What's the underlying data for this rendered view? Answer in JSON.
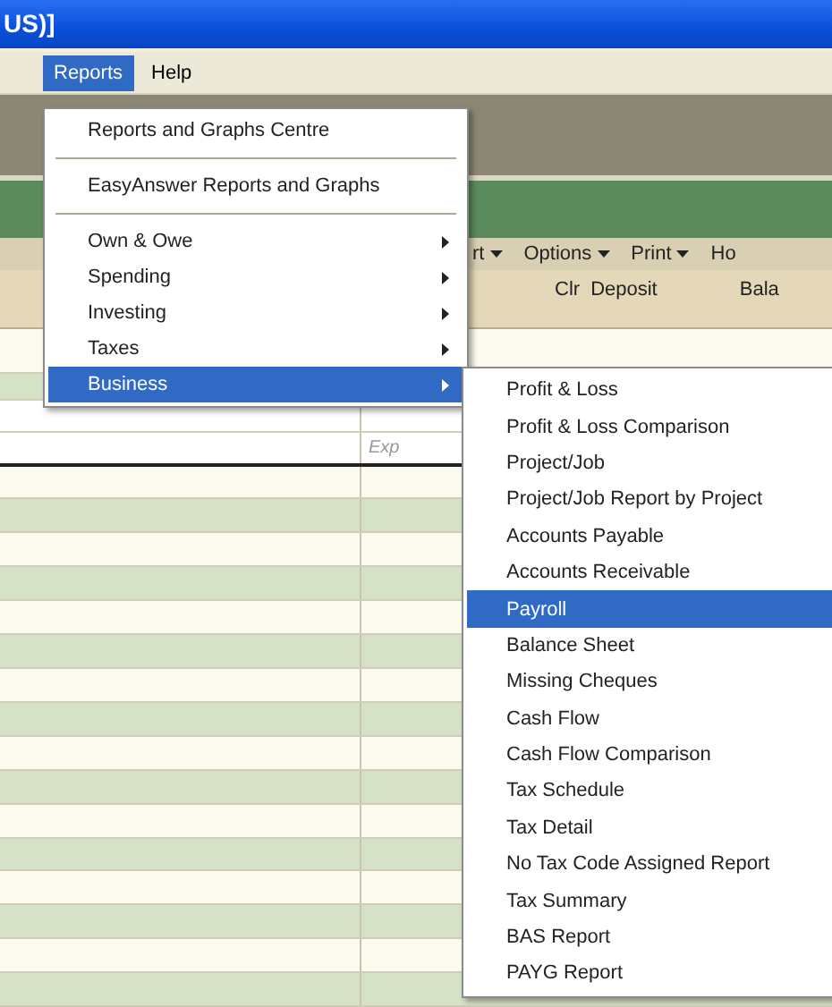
{
  "window": {
    "title": "US)]"
  },
  "menubar": [
    {
      "label": "Reports",
      "selected": true
    },
    {
      "label": "Help",
      "selected": false
    }
  ],
  "toolbar": [
    {
      "label": "rt",
      "dropdown": true
    },
    {
      "label": "Options",
      "dropdown": true
    },
    {
      "label": "Print",
      "dropdown": true
    },
    {
      "label": "Ho",
      "dropdown": false
    }
  ],
  "register": {
    "columns": [
      "Clr",
      "Deposit",
      "Bala"
    ],
    "memo": "Exp"
  },
  "reports_menu": {
    "items": [
      {
        "kind": "item",
        "label": "Reports and Graphs Centre",
        "submenu": false,
        "selected": false
      },
      {
        "kind": "separator"
      },
      {
        "kind": "item",
        "label": "EasyAnswer Reports and Graphs",
        "submenu": false,
        "selected": false
      },
      {
        "kind": "separator"
      },
      {
        "kind": "item",
        "label": "Own & Owe",
        "submenu": true,
        "selected": false
      },
      {
        "kind": "item",
        "label": "Spending",
        "submenu": true,
        "selected": false
      },
      {
        "kind": "item",
        "label": "Investing",
        "submenu": true,
        "selected": false
      },
      {
        "kind": "item",
        "label": "Taxes",
        "submenu": true,
        "selected": false
      },
      {
        "kind": "item",
        "label": "Business",
        "submenu": true,
        "selected": true
      }
    ]
  },
  "business_menu": {
    "items": [
      {
        "label": "Profit & Loss",
        "selected": false
      },
      {
        "label": "Profit & Loss Comparison",
        "selected": false
      },
      {
        "label": "Project/Job",
        "selected": false
      },
      {
        "label": "Project/Job Report by Project",
        "selected": false
      },
      {
        "label": "Accounts Payable",
        "selected": false
      },
      {
        "label": "Accounts Receivable",
        "selected": false
      },
      {
        "label": "Payroll",
        "selected": true
      },
      {
        "label": "Balance Sheet",
        "selected": false
      },
      {
        "label": "Missing Cheques",
        "selected": false
      },
      {
        "label": "Cash Flow",
        "selected": false
      },
      {
        "label": "Cash Flow Comparison",
        "selected": false
      },
      {
        "label": "Tax Schedule",
        "selected": false
      },
      {
        "label": "Tax Detail",
        "selected": false
      },
      {
        "label": "No Tax Code Assigned Report",
        "selected": false
      },
      {
        "label": "Tax Summary",
        "selected": false
      },
      {
        "label": "BAS Report",
        "selected": false
      },
      {
        "label": "PAYG Report",
        "selected": false
      }
    ]
  }
}
